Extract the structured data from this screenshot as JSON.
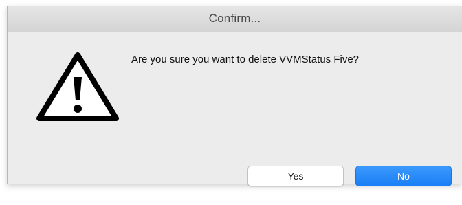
{
  "dialog": {
    "title": "Confirm...",
    "icon": "warning-triangle-icon",
    "message": "Are you sure you want to delete VVMStatus Five?",
    "buttons": {
      "yes_label": "Yes",
      "no_label": "No"
    }
  },
  "colors": {
    "default_button": "#1a7ff6",
    "dialog_background": "#ececec"
  }
}
